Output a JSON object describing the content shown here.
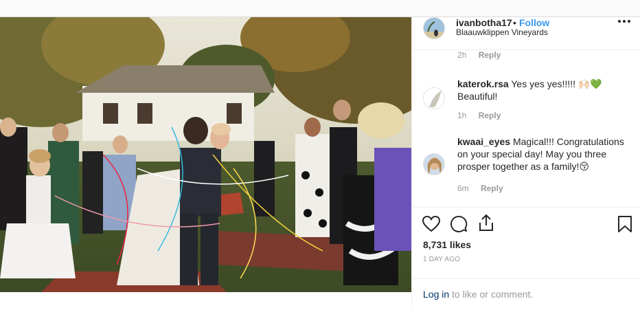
{
  "post": {
    "username": "ivanbotha17",
    "separator": "•",
    "follow_label": "Follow",
    "location": "Blaauwklippen Vineyards"
  },
  "comments": [
    {
      "username": "",
      "text": "",
      "time": "2h",
      "reply_label": "Reply"
    },
    {
      "username": "katerok.rsa",
      "text": "Yes yes yes!!!!! 🙌🏻💚 Beautiful!",
      "time": "1h",
      "reply_label": "Reply"
    },
    {
      "username": "kwaai_eyes",
      "text": "Magical!!! Congratulations on your special day! May you three prosper together as a family!😚",
      "time": "6m",
      "reply_label": "Reply"
    }
  ],
  "actions": {
    "likes": "8,731 likes",
    "posted_ago": "1 DAY AGO"
  },
  "footer": {
    "login_label": "Log in",
    "suffix": " to like or comment."
  },
  "colors": {
    "accent": "#3897f0",
    "link_dark": "#003569",
    "muted": "#999999"
  },
  "icons": [
    "more-icon",
    "heart-icon",
    "comment-icon",
    "share-icon",
    "bookmark-icon"
  ]
}
